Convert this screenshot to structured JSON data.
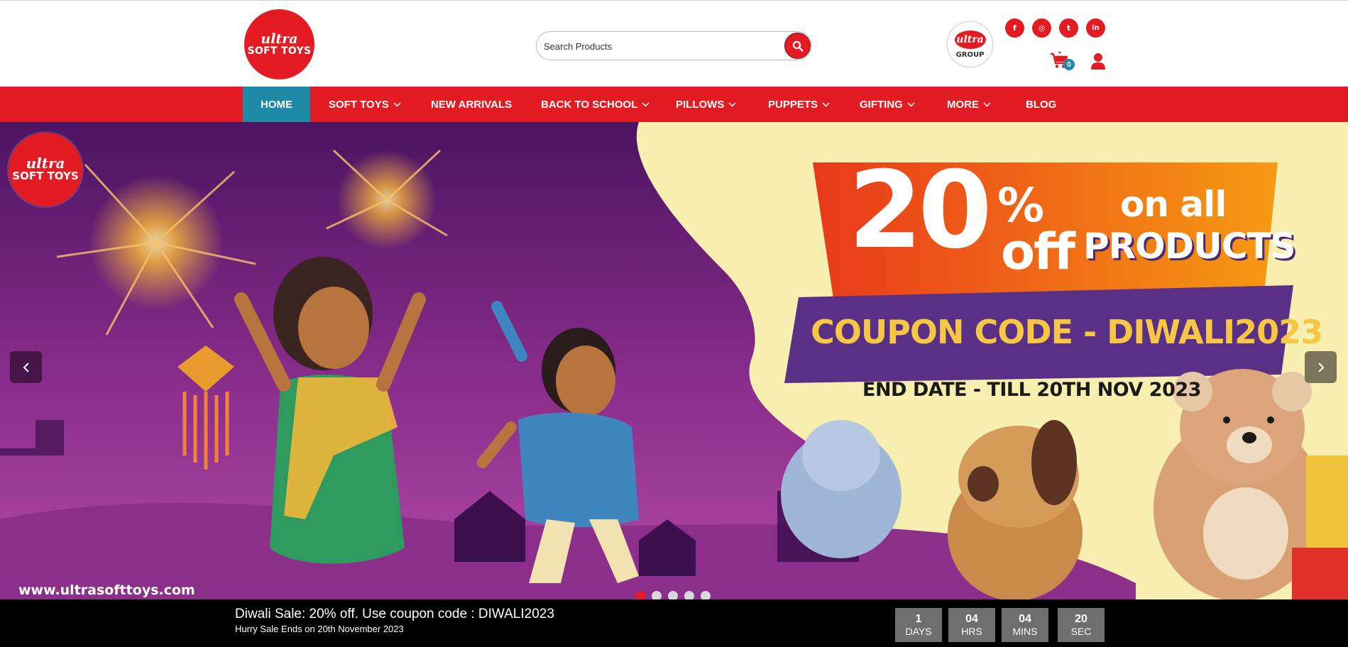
{
  "brand": {
    "logo_top": "ultra",
    "logo_bottom": "SOFT TOYS",
    "group_logo_top": "ultra",
    "group_logo_bottom": "GROUP",
    "primary_color": "#e31b23",
    "active_nav_color": "#1f8aa8"
  },
  "search": {
    "placeholder": "Search Products",
    "button_icon": "search-icon"
  },
  "social": [
    {
      "name": "facebook",
      "icon": "facebook-icon",
      "glyph": "f"
    },
    {
      "name": "instagram",
      "icon": "instagram-icon",
      "glyph": "◎"
    },
    {
      "name": "twitter",
      "icon": "twitter-icon",
      "glyph": "t"
    },
    {
      "name": "linkedin",
      "icon": "linkedin-icon",
      "glyph": "in"
    }
  ],
  "cart": {
    "count": "0",
    "icon": "cart-icon"
  },
  "account": {
    "icon": "user-icon"
  },
  "nav": {
    "items": [
      {
        "label": "HOME",
        "dropdown": false,
        "active": true
      },
      {
        "label": "SOFT TOYS",
        "dropdown": true,
        "active": false
      },
      {
        "label": "NEW ARRIVALS",
        "dropdown": false,
        "active": false
      },
      {
        "label": "BACK TO SCHOOL",
        "dropdown": true,
        "active": false
      },
      {
        "label": "PILLOWS",
        "dropdown": true,
        "active": false
      },
      {
        "label": "PUPPETS",
        "dropdown": true,
        "active": false
      },
      {
        "label": "GIFTING",
        "dropdown": true,
        "active": false
      },
      {
        "label": "MORE",
        "dropdown": true,
        "active": false
      },
      {
        "label": "BLOG",
        "dropdown": false,
        "active": false
      }
    ]
  },
  "hero": {
    "logo_top": "ultra",
    "logo_bottom": "SOFT TOYS",
    "discount": "20",
    "percent_sign": "%",
    "off": "off",
    "on_all": "on all",
    "products": "PRODUCTS",
    "coupon_line": "COUPON CODE - DIWALI2023",
    "end_date_line": "END DATE - TILL 20TH NOV 2023",
    "url": "www.ultrasofttoys.com",
    "slide_count": 5,
    "active_slide": 0,
    "prev_icon": "chevron-left-icon",
    "next_icon": "chevron-right-icon"
  },
  "sale_bar": {
    "title": "Diwali Sale: 20% off. Use coupon code : DIWALI2023",
    "subtitle": "Hurry Sale Ends on 20th November 2023",
    "countdown": [
      {
        "value": "1",
        "unit": "DAYS"
      },
      {
        "value": "04",
        "unit": "HRS"
      },
      {
        "value": "04",
        "unit": "MINS"
      },
      {
        "value": "20",
        "unit": "SEC"
      }
    ]
  }
}
